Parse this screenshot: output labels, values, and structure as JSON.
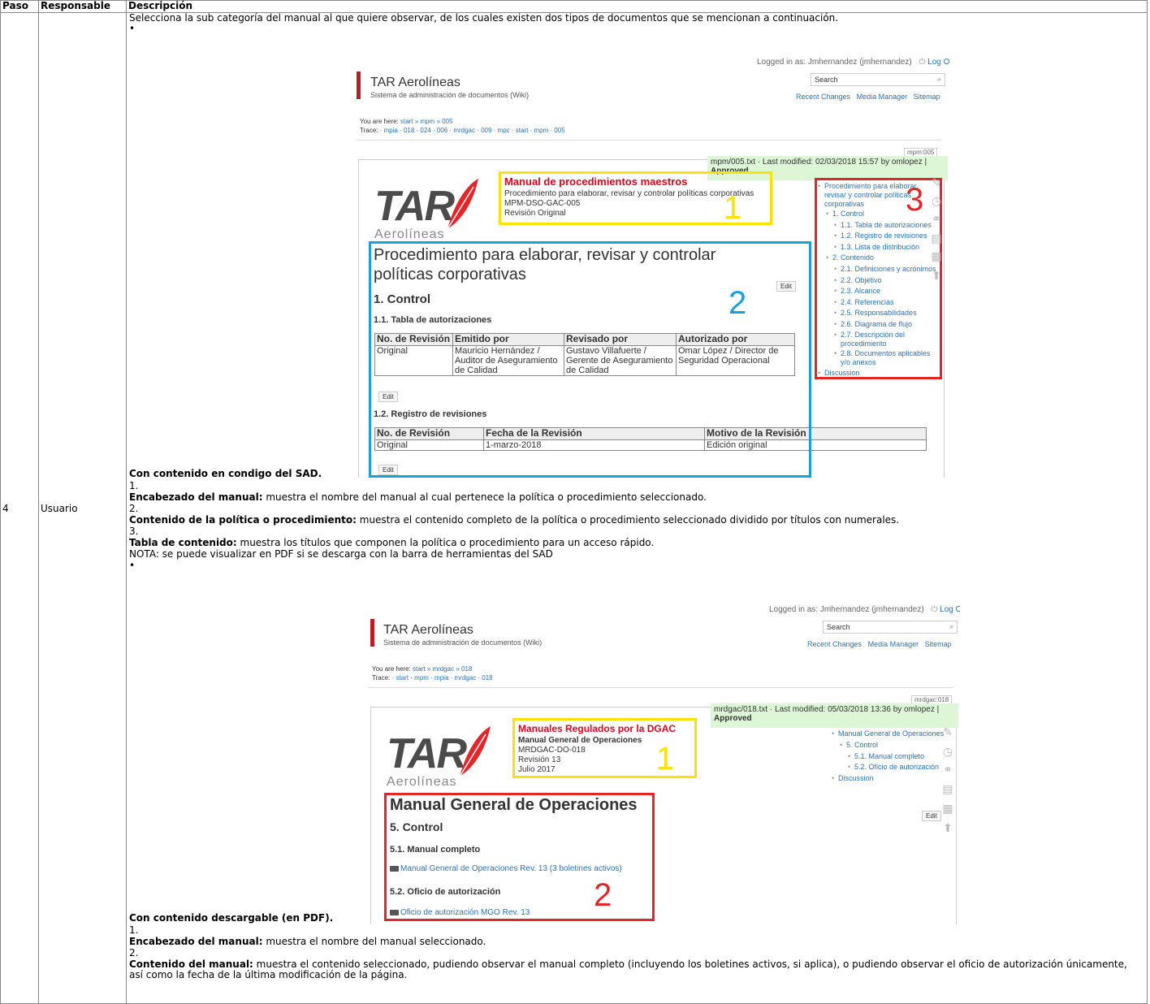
{
  "table": {
    "headers": [
      "Paso",
      "Responsable",
      "Descripción"
    ],
    "step": "4",
    "responsible": "Usuario",
    "intro": "Selecciona la sub categoría del manual al que quiere observar, de los cuales existen dos tipos de documentos que se mencionan a continuación.",
    "bullet": "•",
    "sec1": {
      "caption": "Con contenido en condigo del SAD.",
      "items": [
        {
          "n": "1.",
          "title": "Encabezado del manual:",
          "text": " muestra el nombre del manual al cual pertenece la política o procedimiento seleccionado."
        },
        {
          "n": "2.",
          "title": "Contenido de la política o procedimiento:",
          "text": " muestra el contenido completo de la política o procedimiento seleccionado dividido por títulos con numerales."
        },
        {
          "n": "3.",
          "title": "Tabla de contenido:",
          "text": " muestra los títulos que componen la política o procedimiento para un acceso rápido."
        }
      ],
      "note": "NOTA: se puede visualizar en PDF si se descarga con la barra de herramientas del SAD"
    },
    "sec2": {
      "caption": "Con contenido descargable (en PDF).",
      "items": [
        {
          "n": "1.",
          "title": "Encabezado del manual:",
          "text": " muestra el nombre del manual seleccionado."
        },
        {
          "n": "2.",
          "title": "Contenido del manual:",
          "text": " muestra el contenido seleccionado, pudiendo observar el manual completo (incluyendo los boletines activos, si aplica), o pudiendo observar el oficio de autorización únicamente, así como la fecha de la última modificación de la página."
        }
      ]
    }
  },
  "shot1": {
    "logged": "Logged in as: Jmhernandez (jmhernandez)",
    "logout": "Log Out",
    "site_title": "TAR Aerolíneas",
    "site_sub": "Sistema de administración de documentos (Wiki)",
    "search": "Search",
    "nav": [
      "Recent Changes",
      "Media Manager",
      "Sitemap"
    ],
    "you_are_here": "You are here:",
    "breadcrumb": "start » mpm » 005",
    "trace_label": "Trace:",
    "trace": "· mpia · 018 · 024 · 006 · mrdgac · 009 · mpc · start · mpm · 005",
    "page_id": "mpm:005",
    "modified": "mpm/005.txt · Last modified: 02/03/2018 15:57 by omlopez |",
    "approved": "Approved",
    "logo_tar": "TAR",
    "logo_aero": "Aerolíneas",
    "header_title": "Manual de procedimientos maestros",
    "header_lines": [
      "Procedimiento para elaborar, revisar y controlar políticas corporativas",
      "MPM-DSO-GAC-005",
      "Revisión Original"
    ],
    "h1_line1": "Procedimiento para elaborar, revisar y controlar",
    "h1_line2": "políticas corporativas",
    "h2": "1. Control",
    "h3a": "1.1. Tabla de autorizaciones",
    "t1_headers": [
      "No. de Revisión",
      "Emitido por",
      "Revisado por",
      "Autorizado por"
    ],
    "t1_row": [
      "Original",
      "Mauricio Hernández / Auditor de Aseguramiento de Calidad",
      "Gustavo Villafuerte / Gerente de Aseguramiento de Calidad",
      "Omar López / Director de Seguridad Operacional"
    ],
    "h3b": "1.2. Registro de revisiones",
    "t2_headers": [
      "No. de Revisión",
      "Fecha de la Revisión",
      "Motivo de la Revisión"
    ],
    "t2_row": [
      "Original",
      "1-marzo-2018",
      "Edición original"
    ],
    "edit": "Edit",
    "toc": [
      "Procedimiento para elaborar, revisar y controlar políticas corporativas",
      "1. Control",
      "1.1. Tabla de autorizaciones",
      "1.2. Registro de revisiones",
      "1.3. Lista de distribución",
      "2. Contenido",
      "2.1. Definiciones y acrónimos",
      "2.2. Objetivo",
      "2.3. Alcance",
      "2.4. Referencias",
      "2.5. Responsabilidades",
      "2.6. Diagrama de flujo",
      "2.7. Descripción del procedimiento",
      "2.8. Documentos aplicables y/o anexos",
      "Discussion"
    ],
    "labels": [
      "1",
      "2",
      "3"
    ]
  },
  "shot2": {
    "logged": "Logged in as: Jmhernandez (jmhernandez)",
    "logout": "Log Out",
    "site_title": "TAR Aerolíneas",
    "site_sub": "Sistema de administración de documentos (Wiki)",
    "search": "Search",
    "nav": [
      "Recent Changes",
      "Media Manager",
      "Sitemap"
    ],
    "you_are_here": "You are here:",
    "breadcrumb": "start » mrdgac » 018",
    "trace_label": "Trace:",
    "trace": "· start · mpm · mpia · mrdgac · 018",
    "page_id": "mrdgac:018",
    "modified": "mrdgac/018.txt · Last modified: 05/03/2018 13:36 by omlopez |",
    "approved": "Approved",
    "logo_tar": "TAR",
    "logo_aero": "Aerolíneas",
    "header_title": "Manuales Regulados por la DGAC",
    "header_lines": [
      "Manual General de Operaciones",
      "MRDGAC-DO-018",
      "Revisión 13",
      "Julio 2017"
    ],
    "h1": "Manual General de Operaciones",
    "h2": "5. Control",
    "h3a": "5.1. Manual completo",
    "link1": "Manual General de Operaciones Rev. 13 (3 boletines activos)",
    "h3b": "5.2. Oficio de autorización",
    "link2": "Oficio de autorización MGO Rev. 13",
    "edit": "Edit",
    "toc": [
      "Manual General de Operaciones",
      "5. Control",
      "5.1. Manual completo",
      "5.2. Oficio de autorización",
      "Discussion"
    ],
    "labels": [
      "1",
      "2"
    ]
  }
}
